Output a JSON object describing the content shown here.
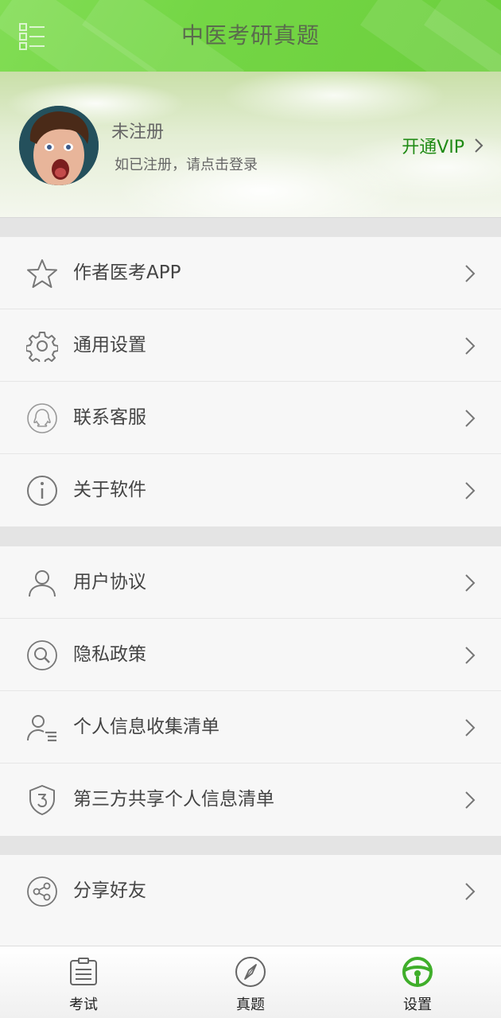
{
  "header": {
    "title": "中医考研真题",
    "menu_icon": "menu-grid-icon",
    "accent_color": "#74d645"
  },
  "profile": {
    "name": "未注册",
    "hint": "如已注册，请点击登录",
    "vip_label": "开通VIP",
    "vip_color": "#1f8a14"
  },
  "groups": [
    {
      "items": [
        {
          "label": "作者医考APP",
          "icon": "star-icon"
        },
        {
          "label": "通用设置",
          "icon": "gear-icon"
        },
        {
          "label": "联系客服",
          "icon": "qq-chat-icon"
        },
        {
          "label": "关于软件",
          "icon": "info-icon"
        }
      ]
    },
    {
      "items": [
        {
          "label": "用户协议",
          "icon": "user-icon"
        },
        {
          "label": "隐私政策",
          "icon": "magnifier-icon"
        },
        {
          "label": "个人信息收集清单",
          "icon": "user-list-icon"
        },
        {
          "label": "第三方共享个人信息清单",
          "icon": "shield-three-icon"
        }
      ]
    },
    {
      "items": [
        {
          "label": "分享好友",
          "icon": "share-icon"
        }
      ]
    }
  ],
  "tabs": [
    {
      "label": "考试",
      "icon": "clipboard-icon",
      "active": false
    },
    {
      "label": "真题",
      "icon": "compass-icon",
      "active": false
    },
    {
      "label": "设置",
      "icon": "steering-wheel-icon",
      "active": true,
      "color": "#3fae2a"
    }
  ]
}
